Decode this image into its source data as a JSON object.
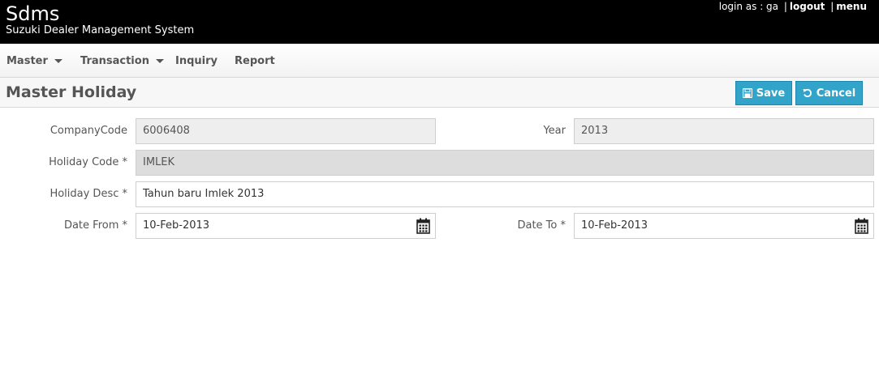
{
  "header": {
    "app_name": "Sdms",
    "app_full_name": "Suzuki Dealer Management System",
    "login_prefix": "login as : ga",
    "separator": "|",
    "logout_label": "logout",
    "menu_label": "menu"
  },
  "nav": {
    "items": [
      {
        "label": "Master",
        "dropdown": true
      },
      {
        "label": "Transaction",
        "dropdown": true
      },
      {
        "label": "Inquiry",
        "dropdown": false
      },
      {
        "label": "Report",
        "dropdown": false
      }
    ]
  },
  "page": {
    "title": "Master Holiday",
    "save_label": "Save",
    "cancel_label": "Cancel",
    "icons": {
      "save": "floppy-disk-icon",
      "cancel": "undo-icon",
      "date": "calendar-icon"
    }
  },
  "form": {
    "company_code": {
      "label": "CompanyCode",
      "value": "6006408"
    },
    "year": {
      "label": "Year",
      "value": "2013"
    },
    "holiday_code": {
      "label": "Holiday Code *",
      "value": "IMLEK"
    },
    "holiday_desc": {
      "label": "Holiday Desc *",
      "value": "Tahun baru Imlek 2013"
    },
    "date_from": {
      "label": "Date From *",
      "value": "10-Feb-2013"
    },
    "date_to": {
      "label": "Date To *",
      "value": "10-Feb-2013"
    }
  },
  "colors": {
    "header_bg": "#000000",
    "button_bg": "#32a3c9",
    "readonly_bg": "#eeeeee",
    "disabled_bg": "#dddddd"
  }
}
